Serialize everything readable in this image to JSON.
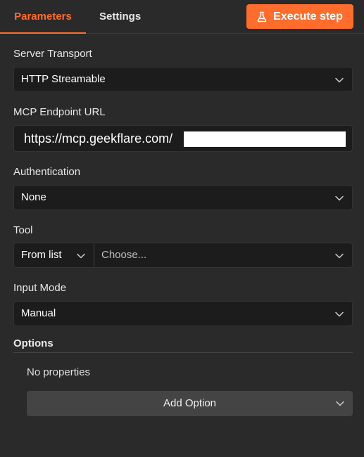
{
  "tabs": {
    "parameters": "Parameters",
    "settings": "Settings"
  },
  "execute_button": {
    "label": "Execute step",
    "icon": "flask-icon",
    "color": "#ff6d2d"
  },
  "fields": {
    "server_transport": {
      "label": "Server Transport",
      "value": "HTTP Streamable"
    },
    "endpoint_url": {
      "label": "MCP Endpoint URL",
      "value": "https://mcp.geekflare.com/"
    },
    "authentication": {
      "label": "Authentication",
      "value": "None"
    },
    "tool": {
      "label": "Tool",
      "mode": "From list",
      "placeholder": "Choose..."
    },
    "input_mode": {
      "label": "Input Mode",
      "value": "Manual"
    }
  },
  "options": {
    "label": "Options",
    "empty_text": "No properties",
    "add_button": "Add Option"
  }
}
